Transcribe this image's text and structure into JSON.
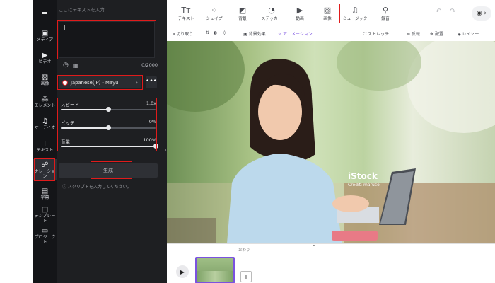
{
  "rail": {
    "menu_icon": "≡",
    "items": [
      {
        "icon": "▣",
        "label": "メディア"
      },
      {
        "icon": "▶",
        "label": "ビデオ"
      },
      {
        "icon": "▨",
        "label": "画像"
      },
      {
        "icon": "⁂",
        "label": "エレメント"
      },
      {
        "icon": "♫",
        "label": "オーディオ"
      },
      {
        "icon": "T",
        "label": "テキスト"
      },
      {
        "icon": "☍",
        "label": "ナレーション"
      },
      {
        "icon": "▤",
        "label": "字幕"
      },
      {
        "icon": "◫",
        "label": "テンプレート"
      },
      {
        "icon": "▭",
        "label": "プロジェクト"
      }
    ]
  },
  "narration": {
    "placeholder": "ここにテキストを入力",
    "textarea_value": "|",
    "count": "0/2000",
    "voice": "Japanese(JP) - Mayu",
    "more": "•••",
    "speed": {
      "label": "スピード",
      "value": "1.0x",
      "level": 0.5
    },
    "pitch": {
      "label": "ピッチ",
      "value": "0%",
      "level": 0.5
    },
    "volume": {
      "label": "音量",
      "value": "100%",
      "level": 1.0
    },
    "generate": "生成",
    "hint": "スクリプトを入力してください。"
  },
  "toolbar": {
    "tools": [
      {
        "icon": "Tт",
        "label": "テキスト"
      },
      {
        "icon": "⁘",
        "label": "シェイプ"
      },
      {
        "icon": "◩",
        "label": "背景"
      },
      {
        "icon": "◔",
        "label": "ステッカー"
      },
      {
        "icon": "▶",
        "label": "動画"
      },
      {
        "icon": "▨",
        "label": "画像"
      },
      {
        "icon": "♫",
        "label": "ミュージック"
      },
      {
        "icon": "⚲",
        "label": "録音"
      }
    ],
    "undo": "↶",
    "redo": "↷",
    "record": "◉ ›"
  },
  "subtoolbar": {
    "crop": "切り取り",
    "bg_effect": "背景効果",
    "animation": "アニメーション",
    "stretch": "ストレッチ",
    "flip": "反転",
    "arrange": "配置",
    "layer": "レイヤー"
  },
  "watermark": {
    "brand": "iStock",
    "credit": "Credit: maruco"
  },
  "timeline": {
    "label": "おわり",
    "play": "▶",
    "add": "+",
    "caret": "⌃"
  },
  "colors": {
    "accent": "#7b52e0",
    "highlight": "#e01b1b",
    "panel": "#1e1f22"
  }
}
